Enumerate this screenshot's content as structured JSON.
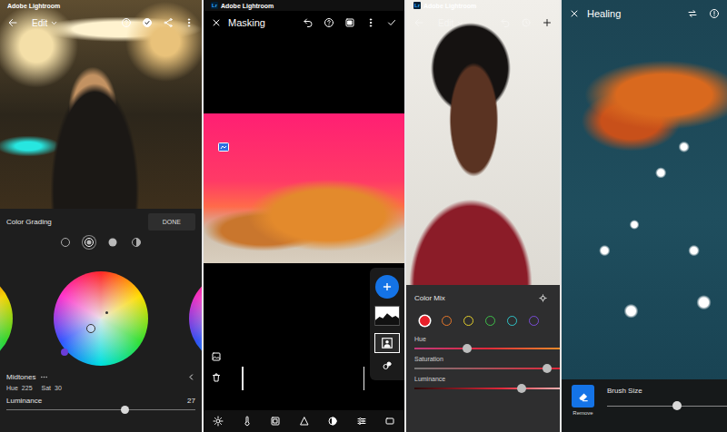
{
  "grading_screen": {
    "app_name": "Adobe Lightroom",
    "title": "Edit",
    "section": "Color Grading",
    "done_button": "DONE",
    "modes": [
      {
        "selected": false
      },
      {
        "selected": true
      },
      {
        "selected": false
      },
      {
        "selected": false
      }
    ],
    "range": "Midtones",
    "hue_label": "Hue",
    "hue": "225",
    "sat_label": "Sat",
    "sat": "30",
    "luminance": {
      "label": "Luminance",
      "reading": "27",
      "level": 0.63
    }
  },
  "masking_screen": {
    "logo": "Lr",
    "app_name": "Adobe Lightroom",
    "title": "Masking",
    "masks": [
      {
        "selected": false
      },
      {
        "selected": true
      }
    ]
  },
  "mix_screen": {
    "logo": "Lr",
    "app_name": "Adobe Lightroom",
    "title": "Edit",
    "panel_title": "Color Mix",
    "swatches": [
      {
        "color": "#e8202a",
        "selected": true
      },
      {
        "color": "#e8782a",
        "selected": false
      },
      {
        "color": "#e5d02c",
        "selected": false
      },
      {
        "color": "#3fbf4a",
        "selected": false
      },
      {
        "color": "#2ec4c8",
        "selected": false
      },
      {
        "color": "#7a4cd8",
        "selected": false
      }
    ],
    "sliders": [
      {
        "label": "Hue",
        "level": 0.36
      },
      {
        "label": "Saturation",
        "level": 0.91
      },
      {
        "label": "Luminance",
        "level": 0.74
      }
    ]
  },
  "healing_screen": {
    "title": "Healing",
    "tool": "Remove",
    "brush": {
      "label": "Brush Size",
      "level": 0.58
    }
  }
}
